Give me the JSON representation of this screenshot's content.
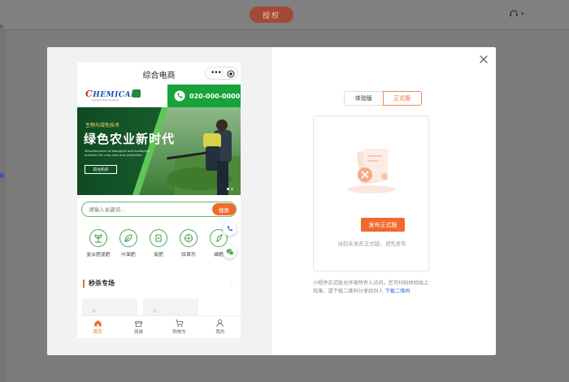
{
  "topbar": {
    "auth_label": "授权"
  },
  "phone": {
    "title": "综合电商",
    "capsule_more": "•••",
    "brand": {
      "logo_first": "C",
      "logo_rest": "HEMICAL",
      "logo_sub": "Grass & Tree Growing",
      "phone_number": "020-000-0000"
    },
    "banner": {
      "tag": "生物与绿色技术",
      "headline": "绿色农业新时代",
      "desc": "Manufacturers of biological and ecological products for crop care and protection",
      "button": "前往购买"
    },
    "search": {
      "placeholder": "请输入关键词...",
      "button": "搜索"
    },
    "categories": [
      {
        "label": "复合肥混肥"
      },
      {
        "label": "叶面肥"
      },
      {
        "label": "氮肥"
      },
      {
        "label": "除草剂"
      },
      {
        "label": "磷肥"
      }
    ],
    "flash_sale": {
      "title": "秒杀专场",
      "arrow": "›"
    },
    "tabbar": [
      {
        "label": "首页"
      },
      {
        "label": "商城"
      },
      {
        "label": "购物车"
      },
      {
        "label": "我的"
      }
    ]
  },
  "right": {
    "tabs": [
      {
        "label": "体验版"
      },
      {
        "label": "正式版"
      }
    ],
    "publish_button": "发布正式版",
    "publish_hint": "当前未发布正式版，请先发布",
    "note_text": "小程序正式版允许被所有人访问。您可扫码体验线上效果，或下载二维码分享给别人",
    "note_link": "下载二维码"
  },
  "colors": {
    "accent": "#ef6a2b",
    "green": "#17a33a",
    "link": "#3465c9"
  }
}
